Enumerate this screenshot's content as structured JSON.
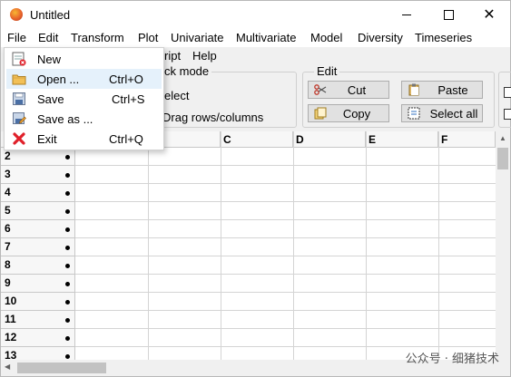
{
  "window": {
    "title": "Untitled"
  },
  "menubar": [
    "File",
    "Edit",
    "Transform",
    "Plot",
    "Univariate",
    "Multivariate",
    "Model",
    "Diversity",
    "Timeseries"
  ],
  "menubar2": {
    "partial_script": "ript",
    "help": "Help"
  },
  "click_mode": {
    "title_partial": "ck mode",
    "select_partial": "elect",
    "drag_partial": "Drag rows/columns"
  },
  "edit_group": {
    "title": "Edit",
    "cut": "Cut",
    "copy": "Copy",
    "paste": "Paste",
    "select_all": "Select all"
  },
  "file_menu": [
    {
      "label": "New",
      "shortcut": "",
      "icon": "new-file-icon"
    },
    {
      "label": "Open ...",
      "shortcut": "Ctrl+O",
      "icon": "folder-icon"
    },
    {
      "label": "Save",
      "shortcut": "Ctrl+S",
      "icon": "floppy-icon"
    },
    {
      "label": "Save as ...",
      "shortcut": "",
      "icon": "save-as-icon"
    },
    {
      "label": "Exit",
      "shortcut": "Ctrl+Q",
      "icon": "red-x-icon"
    }
  ],
  "sheet": {
    "columns": [
      "C",
      "D",
      "E",
      "F"
    ],
    "rows": [
      "2",
      "3",
      "4",
      "5",
      "6",
      "7",
      "8",
      "9",
      "10",
      "11",
      "12",
      "13"
    ]
  },
  "watermark": "公众号 · 细猪技术",
  "colors": {
    "highlight": "#e5f1fb",
    "accent_red": "#e0202a"
  }
}
